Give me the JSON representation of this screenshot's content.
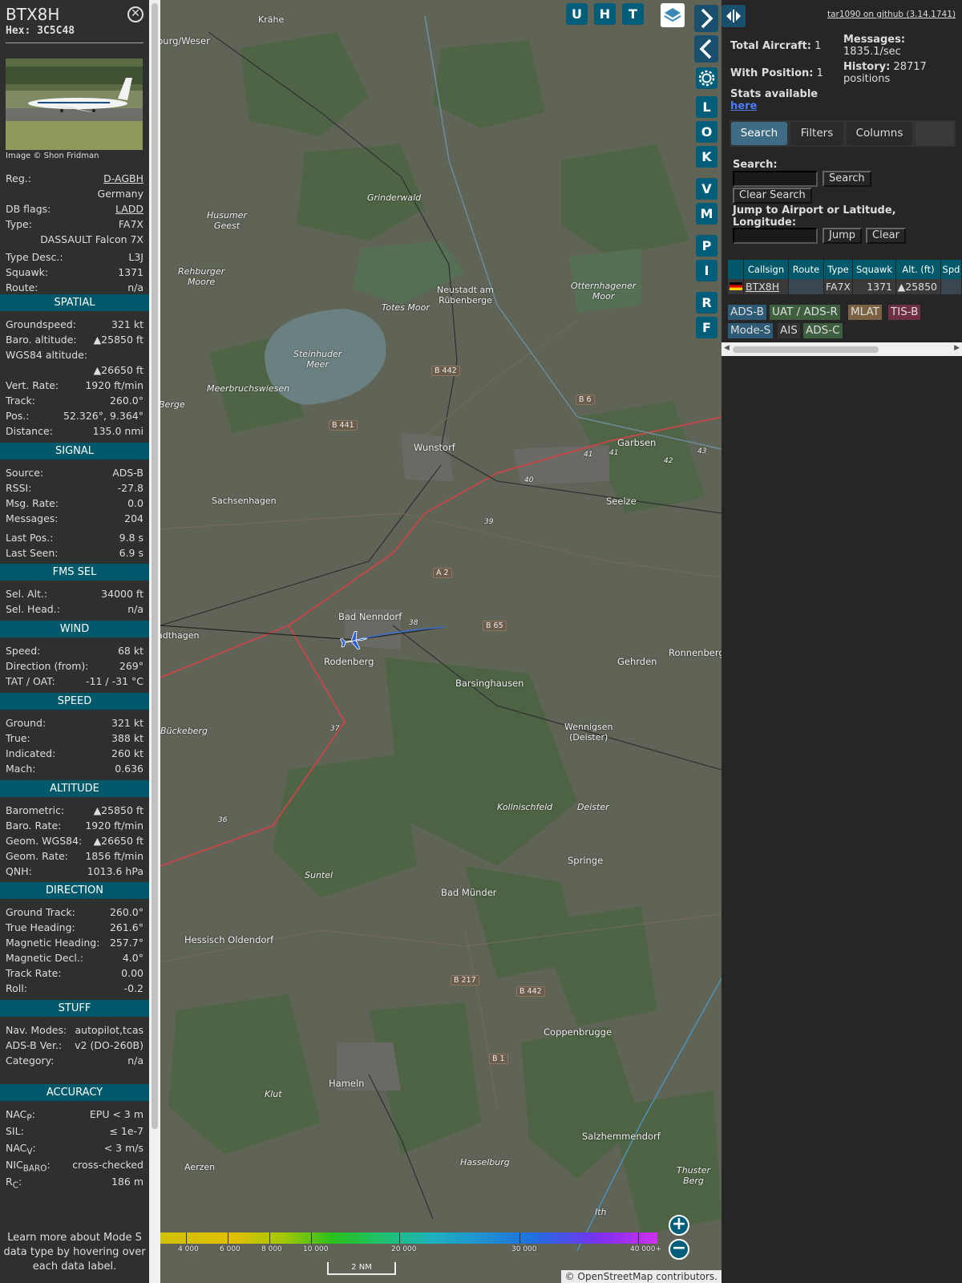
{
  "aircraft": {
    "callsign": "BTX8H",
    "hex_label": "Hex: 3C5C48",
    "close_glyph": "✕",
    "image_credit": "Image © Shon Fridman",
    "info": [
      {
        "k": "Reg.:",
        "v": "D-AGBH",
        "link": true
      },
      {
        "k": "",
        "v": "Germany"
      },
      {
        "k": "DB flags:",
        "v": "LADD",
        "link": true
      },
      {
        "k": "Type:",
        "v": "FA7X"
      },
      {
        "k": "",
        "v": "DASSAULT Falcon 7X"
      },
      {
        "k": "Type Desc.:",
        "v": "L3J"
      },
      {
        "k": "Squawk:",
        "v": "1371"
      },
      {
        "k": "Route:",
        "v": "n/a"
      }
    ]
  },
  "sections": [
    {
      "title": "SPATIAL",
      "rows": [
        {
          "k": "Groundspeed:",
          "v": "321 kt"
        },
        {
          "k": "Baro. altitude:",
          "v": "▲25850 ft"
        },
        {
          "k": "WGS84 altitude:",
          "v": ""
        },
        {
          "k": "",
          "v": "▲26650 ft"
        },
        {
          "k": "Vert. Rate:",
          "v": "1920 ft/min"
        },
        {
          "k": "Track:",
          "v": "260.0°"
        },
        {
          "k": "Pos.:",
          "v": "52.326°, 9.364°"
        },
        {
          "k": "Distance:",
          "v": "135.0 nmi"
        }
      ]
    },
    {
      "title": "SIGNAL",
      "rows": [
        {
          "k": "Source:",
          "v": "ADS-B"
        },
        {
          "k": "RSSI:",
          "v": "-27.8"
        },
        {
          "k": "Msg. Rate:",
          "v": "0.0"
        },
        {
          "k": "Messages:",
          "v": "204"
        },
        {
          "k": "Last Pos.:",
          "v": "9.8 s"
        },
        {
          "k": "Last Seen:",
          "v": "6.9 s"
        }
      ]
    },
    {
      "title": "FMS SEL",
      "rows": [
        {
          "k": "Sel. Alt.:",
          "v": "34000 ft"
        },
        {
          "k": "Sel. Head.:",
          "v": "n/a"
        }
      ]
    },
    {
      "title": "WIND",
      "rows": [
        {
          "k": "Speed:",
          "v": "68 kt"
        },
        {
          "k": "Direction (from):",
          "v": "269°"
        },
        {
          "k": "TAT / OAT:",
          "v": "-11 / -31 °C"
        }
      ]
    },
    {
      "title": "SPEED",
      "rows": [
        {
          "k": "Ground:",
          "v": "321 kt"
        },
        {
          "k": "True:",
          "v": "388 kt"
        },
        {
          "k": "Indicated:",
          "v": "260 kt"
        },
        {
          "k": "Mach:",
          "v": "0.636"
        }
      ]
    },
    {
      "title": "ALTITUDE",
      "rows": [
        {
          "k": "Barometric:",
          "v": "▲25850 ft"
        },
        {
          "k": "Baro. Rate:",
          "v": "1920 ft/min"
        },
        {
          "k": "Geom. WGS84:",
          "v": "▲26650 ft"
        },
        {
          "k": "Geom. Rate:",
          "v": "1856 ft/min"
        },
        {
          "k": "QNH:",
          "v": "1013.6 hPa"
        }
      ]
    },
    {
      "title": "DIRECTION",
      "rows": [
        {
          "k": "Ground Track:",
          "v": "260.0°"
        },
        {
          "k": "True Heading:",
          "v": "261.6°"
        },
        {
          "k": "Magnetic Heading:",
          "v": "257.7°"
        },
        {
          "k": "Magnetic Decl.:",
          "v": "4.0°"
        },
        {
          "k": "Track Rate:",
          "v": "0.00"
        },
        {
          "k": "Roll:",
          "v": "-0.2"
        }
      ]
    },
    {
      "title": "STUFF",
      "rows": [
        {
          "k": "Nav. Modes:",
          "v": "autopilot,tcas"
        },
        {
          "k": "ADS-B Ver.:",
          "v": "v2 (DO-260B)"
        },
        {
          "k": "Category:",
          "v": "n/a"
        }
      ]
    },
    {
      "title": "ACCURACY",
      "rows": [
        {
          "k": "NACP:",
          "v": "EPU < 3 m"
        },
        {
          "k": "SIL:",
          "v": "≤ 1e-7"
        },
        {
          "k": "NACV:",
          "v": "< 3 m/s"
        },
        {
          "k": "NICBARO:",
          "v": "cross-checked"
        },
        {
          "k": "RC:",
          "v": "186 m"
        }
      ]
    }
  ],
  "learn_more": "Learn more about Mode S data type by hovering over each data label.",
  "map": {
    "top_buttons": [
      "U",
      "H",
      "T"
    ],
    "side_buttons": [
      "L",
      "O",
      "K",
      "V",
      "M",
      "P",
      "I",
      "R",
      "F"
    ],
    "places": [
      {
        "n": "Krähe"
      },
      {
        "n": "burg/Weser"
      },
      {
        "n": "Grinderwald"
      },
      {
        "n": "Husumer Geest"
      },
      {
        "n": "Rehburger Moore"
      },
      {
        "n": "Totes Moor"
      },
      {
        "n": "Steinhuder Meer"
      },
      {
        "n": "Neustadt am Rübenberge"
      },
      {
        "n": "Otternhagener Moor"
      },
      {
        "n": "Meerbruchswiesen"
      },
      {
        "n": "Berge"
      },
      {
        "n": "Wunstorf"
      },
      {
        "n": "Garbsen"
      },
      {
        "n": "Sachsenhagen"
      },
      {
        "n": "Seelze"
      },
      {
        "n": "Bad Nenndorf"
      },
      {
        "n": "adthagen"
      },
      {
        "n": "Rodenberg"
      },
      {
        "n": "Barsinghausen"
      },
      {
        "n": "Gehrden"
      },
      {
        "n": "Ronnenberg"
      },
      {
        "n": "Bückeberg"
      },
      {
        "n": "Wennigsen (Deister)"
      },
      {
        "n": "Kollnischfeld"
      },
      {
        "n": "Deister"
      },
      {
        "n": "Suntel"
      },
      {
        "n": "Springe"
      },
      {
        "n": "Bad Münder"
      },
      {
        "n": "Hessisch Oldendorf"
      },
      {
        "n": "Coppenbrugge"
      },
      {
        "n": "Hameln"
      },
      {
        "n": "Klut"
      },
      {
        "n": "Aerzen"
      },
      {
        "n": "Hasselburg"
      },
      {
        "n": "Salzhemmendorf"
      },
      {
        "n": "Thuster Berg"
      },
      {
        "n": "Ith"
      }
    ],
    "roads": [
      "B 442",
      "B 6",
      "B 441",
      "A 2",
      "B 65",
      "B 217",
      "B 442",
      "B 1"
    ],
    "exits": [
      "41",
      "41",
      "42",
      "43",
      "40",
      "39",
      "38",
      "37",
      "36"
    ],
    "altitude_scale": [
      "4 000",
      "6 000",
      "8 000",
      "10 000",
      "20 000",
      "30 000",
      "40 000+"
    ],
    "scale_label": "2 NM",
    "attribution": "© OpenStreetMap contributors.",
    "zoom_in": "+",
    "zoom_out": "−"
  },
  "panel": {
    "version_link": "tar1090 on github (3.14.1741)",
    "total_aircraft_label": "Total Aircraft:",
    "total_aircraft": "1",
    "with_position_label": "With Position:",
    "with_position": "1",
    "messages_label": "Messages:",
    "messages_rate": "1835.1/sec",
    "history_label": "History:",
    "history_value": "28717 positions",
    "stats_label": "Stats available",
    "stats_link": "here",
    "tabs": [
      "Search",
      "Filters",
      "Columns"
    ],
    "search_label": "Search:",
    "search_button": "Search",
    "clear_search_button": "Clear Search",
    "jump_label": "Jump to Airport or Latitude, Longitude:",
    "jump_button": "Jump",
    "clear_button": "Clear",
    "table_headers": [
      "Callsign",
      "Route",
      "Type",
      "Squawk",
      "Alt. (ft)",
      "Spd"
    ],
    "table_row": {
      "callsign": "BTX8H",
      "route": "",
      "type": "FA7X",
      "squawk": "1371",
      "alt": "▲25850"
    },
    "badges": [
      {
        "label": "ADS-B",
        "color": "#2d5a74"
      },
      {
        "label": "UAT / ADS-R",
        "color": "#3d5e3f"
      },
      {
        "label": "MLAT",
        "color": "#7a6242"
      },
      {
        "label": "TIS-B",
        "color": "#6e2f44"
      },
      {
        "label": "Mode-S",
        "color": "#2d5a74"
      },
      {
        "label": "AIS",
        "color": "#333333"
      },
      {
        "label": "ADS-C",
        "color": "#3d5e3f"
      }
    ]
  }
}
